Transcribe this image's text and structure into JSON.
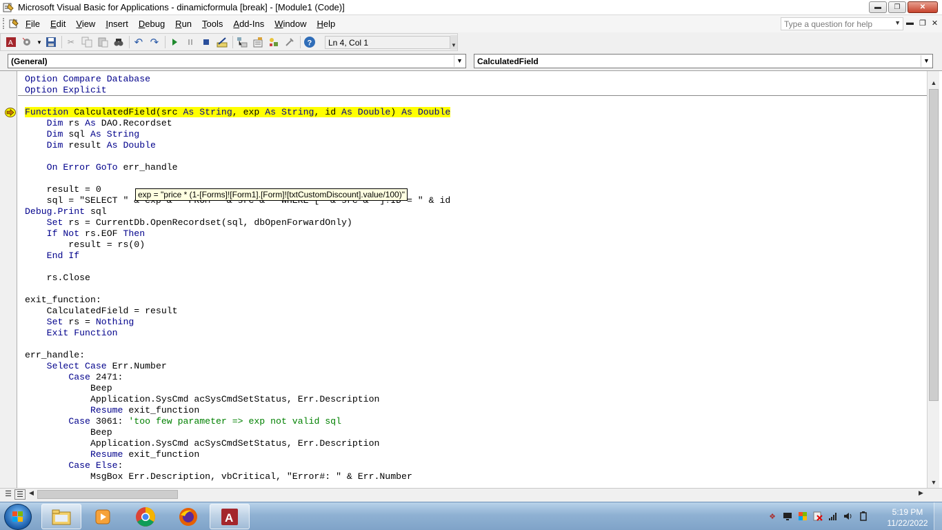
{
  "window": {
    "title": "Microsoft Visual Basic for Applications - dinamicformula [break] - [Module1 (Code)]",
    "buttons": [
      "minimize",
      "restore",
      "close"
    ]
  },
  "menubar": {
    "items": [
      "File",
      "Edit",
      "View",
      "Insert",
      "Debug",
      "Run",
      "Tools",
      "Add-Ins",
      "Window",
      "Help"
    ],
    "help_placeholder": "Type a question for help"
  },
  "toolbar": {
    "position": "Ln 4, Col 1",
    "icons": [
      "view-access-icon",
      "insert-module-icon",
      "save-icon",
      "cut-icon",
      "copy-icon",
      "paste-icon",
      "find-icon",
      "undo-icon",
      "redo-icon",
      "run-icon",
      "break-icon",
      "reset-icon",
      "design-mode-icon",
      "project-explorer-icon",
      "properties-icon",
      "object-browser-icon",
      "toolbox-icon",
      "help-icon"
    ]
  },
  "combos": {
    "object": "(General)",
    "procedure": "CalculatedField"
  },
  "tooltip": "exp = \"price * (1-[Forms]![Form1].[Form]![txtCustomDiscount].value/100)\"",
  "code_lines": [
    [
      {
        "t": "Option Compare Database",
        "c": "kw"
      }
    ],
    [
      {
        "t": "Option Explicit",
        "c": "kw"
      }
    ],
    [
      {
        "t": ""
      }
    ],
    [
      {
        "t": "Function",
        "c": "kw"
      },
      {
        "t": " CalculatedField(src "
      },
      {
        "t": "As String",
        "c": "kw"
      },
      {
        "t": ", exp "
      },
      {
        "t": "As String",
        "c": "kw"
      },
      {
        "t": ", id "
      },
      {
        "t": "As Double",
        "c": "kw"
      },
      {
        "t": ") "
      },
      {
        "t": "As Double",
        "c": "kw"
      }
    ],
    [
      {
        "t": "    "
      },
      {
        "t": "Dim",
        "c": "kw"
      },
      {
        "t": " rs "
      },
      {
        "t": "As",
        "c": "kw"
      },
      {
        "t": " DAO.Recordset"
      }
    ],
    [
      {
        "t": "    "
      },
      {
        "t": "Dim",
        "c": "kw"
      },
      {
        "t": " sql "
      },
      {
        "t": "As String",
        "c": "kw"
      }
    ],
    [
      {
        "t": "    "
      },
      {
        "t": "Dim",
        "c": "kw"
      },
      {
        "t": " result "
      },
      {
        "t": "As Double",
        "c": "kw"
      }
    ],
    [
      {
        "t": ""
      }
    ],
    [
      {
        "t": "    "
      },
      {
        "t": "On Error GoTo",
        "c": "kw"
      },
      {
        "t": " err_handle"
      }
    ],
    [
      {
        "t": ""
      }
    ],
    [
      {
        "t": "    result = 0"
      }
    ],
    [
      {
        "t": "    sql = \"SELECT \" & exp & \" FROM \" & src & \" WHERE [\" & src & \"]!ID = \" & id"
      }
    ],
    [
      {
        "t": "Debug.Print",
        "c": "kw"
      },
      {
        "t": " sql"
      }
    ],
    [
      {
        "t": "    "
      },
      {
        "t": "Set",
        "c": "kw"
      },
      {
        "t": " rs = CurrentDb.OpenRecordset(sql, dbOpenForwardOnly)"
      }
    ],
    [
      {
        "t": "    "
      },
      {
        "t": "If Not",
        "c": "kw"
      },
      {
        "t": " rs.EOF "
      },
      {
        "t": "Then",
        "c": "kw"
      }
    ],
    [
      {
        "t": "        result = rs(0)"
      }
    ],
    [
      {
        "t": "    "
      },
      {
        "t": "End If",
        "c": "kw"
      }
    ],
    [
      {
        "t": ""
      }
    ],
    [
      {
        "t": "    rs.Close"
      }
    ],
    [
      {
        "t": ""
      }
    ],
    [
      {
        "t": "exit_function:"
      }
    ],
    [
      {
        "t": "    CalculatedField = result"
      }
    ],
    [
      {
        "t": "    "
      },
      {
        "t": "Set",
        "c": "kw"
      },
      {
        "t": " rs = "
      },
      {
        "t": "Nothing",
        "c": "kw"
      }
    ],
    [
      {
        "t": "    "
      },
      {
        "t": "Exit Function",
        "c": "kw"
      }
    ],
    [
      {
        "t": ""
      }
    ],
    [
      {
        "t": "err_handle:"
      }
    ],
    [
      {
        "t": "    "
      },
      {
        "t": "Select Case",
        "c": "kw"
      },
      {
        "t": " Err.Number"
      }
    ],
    [
      {
        "t": "        "
      },
      {
        "t": "Case",
        "c": "kw"
      },
      {
        "t": " 2471:"
      }
    ],
    [
      {
        "t": "            Beep"
      }
    ],
    [
      {
        "t": "            Application.SysCmd acSysCmdSetStatus, Err.Description"
      }
    ],
    [
      {
        "t": "            "
      },
      {
        "t": "Resume",
        "c": "kw"
      },
      {
        "t": " exit_function"
      }
    ],
    [
      {
        "t": "        "
      },
      {
        "t": "Case",
        "c": "kw"
      },
      {
        "t": " 3061: "
      },
      {
        "t": "'too few parameter => exp not valid sql",
        "c": "cm"
      }
    ],
    [
      {
        "t": "            Beep"
      }
    ],
    [
      {
        "t": "            Application.SysCmd acSysCmdSetStatus, Err.Description"
      }
    ],
    [
      {
        "t": "            "
      },
      {
        "t": "Resume",
        "c": "kw"
      },
      {
        "t": " exit_function"
      }
    ],
    [
      {
        "t": "        "
      },
      {
        "t": "Case Else",
        "c": "kw"
      },
      {
        "t": ":"
      }
    ],
    [
      {
        "t": "            MsgBox Err.Description, vbCritical, \"Error#: \" & Err.Number"
      }
    ]
  ],
  "highlight_line": 3,
  "colors": {
    "keyword": "#00008b",
    "comment": "#008000",
    "highlight": "#ffff00",
    "tooltip_bg": "#ffffe1"
  },
  "taskbar": {
    "apps": [
      "explorer-icon",
      "media-player-icon",
      "chrome-icon",
      "firefox-icon",
      "access-icon"
    ],
    "tray_icons": [
      "network-tool-icon",
      "monitor-icon",
      "flag-icon",
      "action-center-icon",
      "signal-icon",
      "volume-icon",
      "power-icon"
    ],
    "time": "5:19 PM",
    "date": "11/22/2022"
  }
}
